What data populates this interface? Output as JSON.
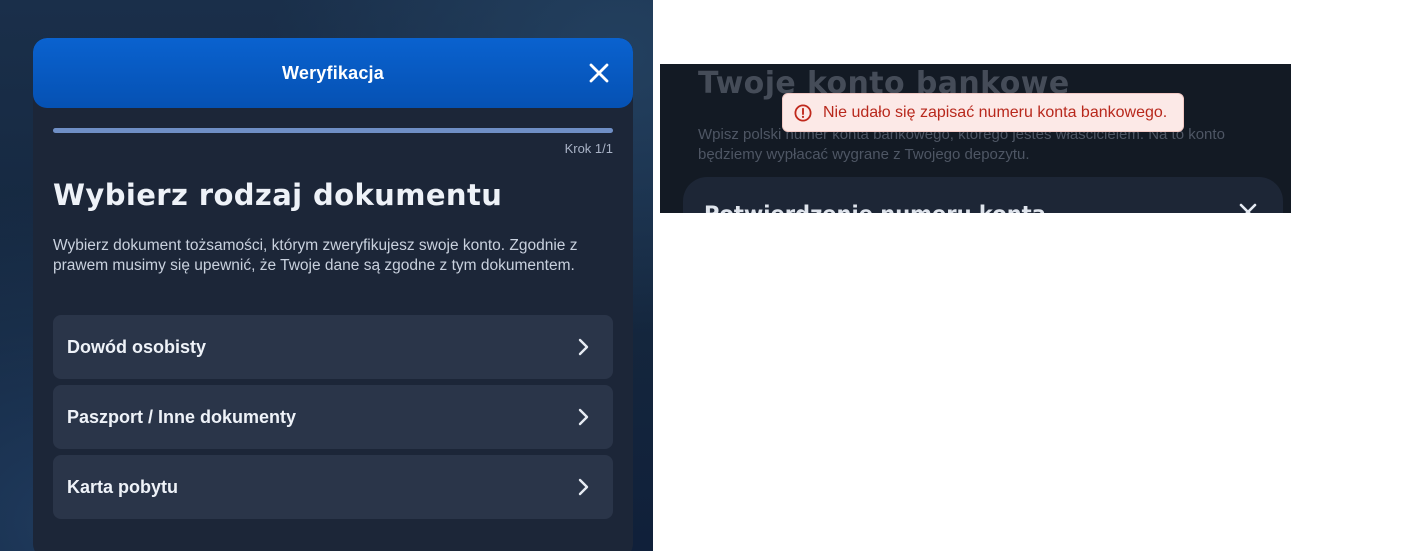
{
  "verification_modal": {
    "title": "Weryfikacja",
    "progress": 1.0,
    "step_label": "Krok 1/1",
    "heading": "Wybierz rodzaj dokumentu",
    "description": "Wybierz dokument tożsamości, którym zweryfikujesz swoje konto. Zgodnie z prawem musimy się upewnić, że Twoje dane są zgodne z tym dokumentem.",
    "options": [
      {
        "label": "Dowód osobisty",
        "icon": "chevron-right-icon"
      },
      {
        "label": "Paszport / Inne dokumenty",
        "icon": "chevron-right-icon"
      },
      {
        "label": "Karta pobytu",
        "icon": "chevron-right-icon"
      }
    ],
    "close_icon": "close-icon",
    "colors": {
      "header": "#0a5fc9",
      "panel": "#1c2638",
      "option_bg": "#2a3549",
      "progress": "#6f8fc6"
    }
  },
  "bank_account_panel": {
    "title": "Twoje konto bankowe",
    "description": "Wpisz polski numer konta bankowego, którego jesteś właścicielem. Na to konto będziemy wypłacać wygrane z Twojego depozytu.",
    "confirm_card_title": "Potwierdzenie numeru konta",
    "close_icon": "close-icon"
  },
  "error_toast": {
    "message": "Nie udało się zapisać numeru konta bankowego.",
    "icon": "error-circle-icon",
    "colors": {
      "bg": "#fce9e7",
      "text": "#b8281c"
    }
  }
}
